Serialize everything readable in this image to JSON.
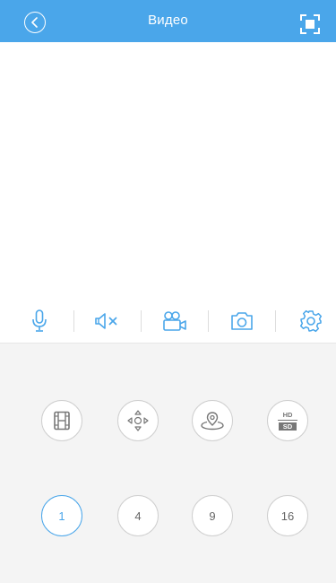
{
  "header": {
    "title": "Видео",
    "back_icon": "chevron-left-icon",
    "fullscreen_icon": "fullscreen-icon"
  },
  "toolbar": {
    "items": [
      {
        "icon": "microphone-icon"
      },
      {
        "icon": "speaker-mute-icon"
      },
      {
        "icon": "video-record-icon"
      },
      {
        "icon": "camera-icon"
      },
      {
        "icon": "settings-icon"
      }
    ]
  },
  "controls": {
    "row1": [
      {
        "icon": "film-icon"
      },
      {
        "icon": "ptz-direction-icon"
      },
      {
        "icon": "preset-position-icon"
      },
      {
        "icon": "hd-sd-icon",
        "hd_label": "HD",
        "sd_label": "SD"
      }
    ],
    "grid_options": [
      "1",
      "4",
      "9",
      "16"
    ],
    "selected_grid": "1"
  },
  "colors": {
    "accent": "#4aa6ea",
    "panel_bg": "#f4f4f4",
    "icon_gray": "#888888"
  }
}
